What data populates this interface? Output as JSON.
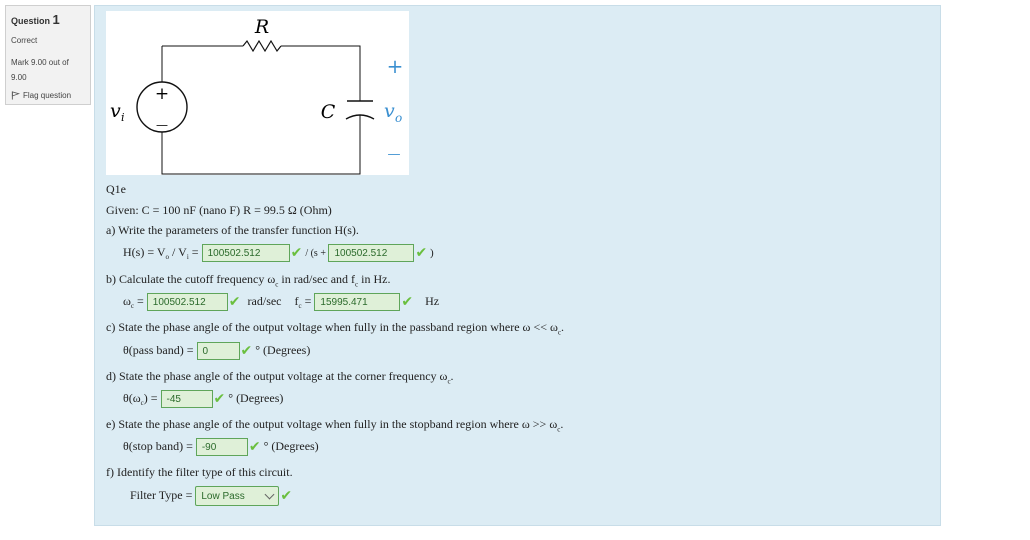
{
  "info": {
    "question_label": "Question",
    "question_number": "1",
    "state": "Correct",
    "grade_line1": "Mark 9.00 out of",
    "grade_line2": "9.00",
    "flag_label": "Flag question"
  },
  "circuit": {
    "resistor_label": "R",
    "capacitor_label": "C",
    "source_label": "v",
    "source_sub": "i",
    "output_label": "v",
    "output_sub": "o",
    "plus": "+",
    "minus": "—",
    "src_plus": "+",
    "src_minus": "—"
  },
  "q": {
    "title": "Q1e",
    "given": "Given: C = 100 nF (nano F)   R = 99.5 Ω (Ohm)",
    "a_text": "a)  Write the parameters of the transfer function H(s).",
    "a_prefix": "H(s) = V",
    "a_sub_o": "o",
    "a_mid": " / V",
    "a_sub_i": "i",
    "a_eq": " =",
    "a_val1": "100502.512",
    "a_sep": " / (s + ",
    "a_val2": "100502.512",
    "a_close": " )",
    "b_text_pre": "b)  Calculate the cutoff frequency ω",
    "b_text_sub": "c",
    "b_text_mid": " in rad/sec and f",
    "b_text_sub2": "c",
    "b_text_post": " in Hz.",
    "b_omega": "ω",
    "b_omega_sub": "c",
    "b_omega_eq": " =",
    "b_val1": "100502.512",
    "b_unit1": "rad/sec",
    "b_f": "f",
    "b_f_sub": "c",
    "b_f_eq": " =",
    "b_val2": "15995.471",
    "b_unit2": "Hz",
    "c_text_pre": "c)  State the phase angle of the output voltage when fully in the passband region where ω << ω",
    "c_text_sub": "c",
    "c_text_post": ".",
    "c_label": "θ(pass band) =",
    "c_val": "0",
    "deg_unit": "° (Degrees)",
    "d_text_pre": "d)  State the phase angle of the output voltage at the corner frequency ω",
    "d_text_sub": "c",
    "d_text_post": ".",
    "d_label_pre": "θ(ω",
    "d_label_sub": "c",
    "d_label_post": ") =",
    "d_val": "-45",
    "e_text_pre": "e)  State the phase angle of the output voltage when fully in the stopband region where ω >> ω",
    "e_text_sub": "c",
    "e_text_post": ".",
    "e_label": "θ(stop band) =",
    "e_val": "-90",
    "f_text": "f)  Identify the filter type of this circuit.",
    "f_label": "Filter Type =",
    "f_selected": "Low Pass",
    "check": "✔"
  }
}
